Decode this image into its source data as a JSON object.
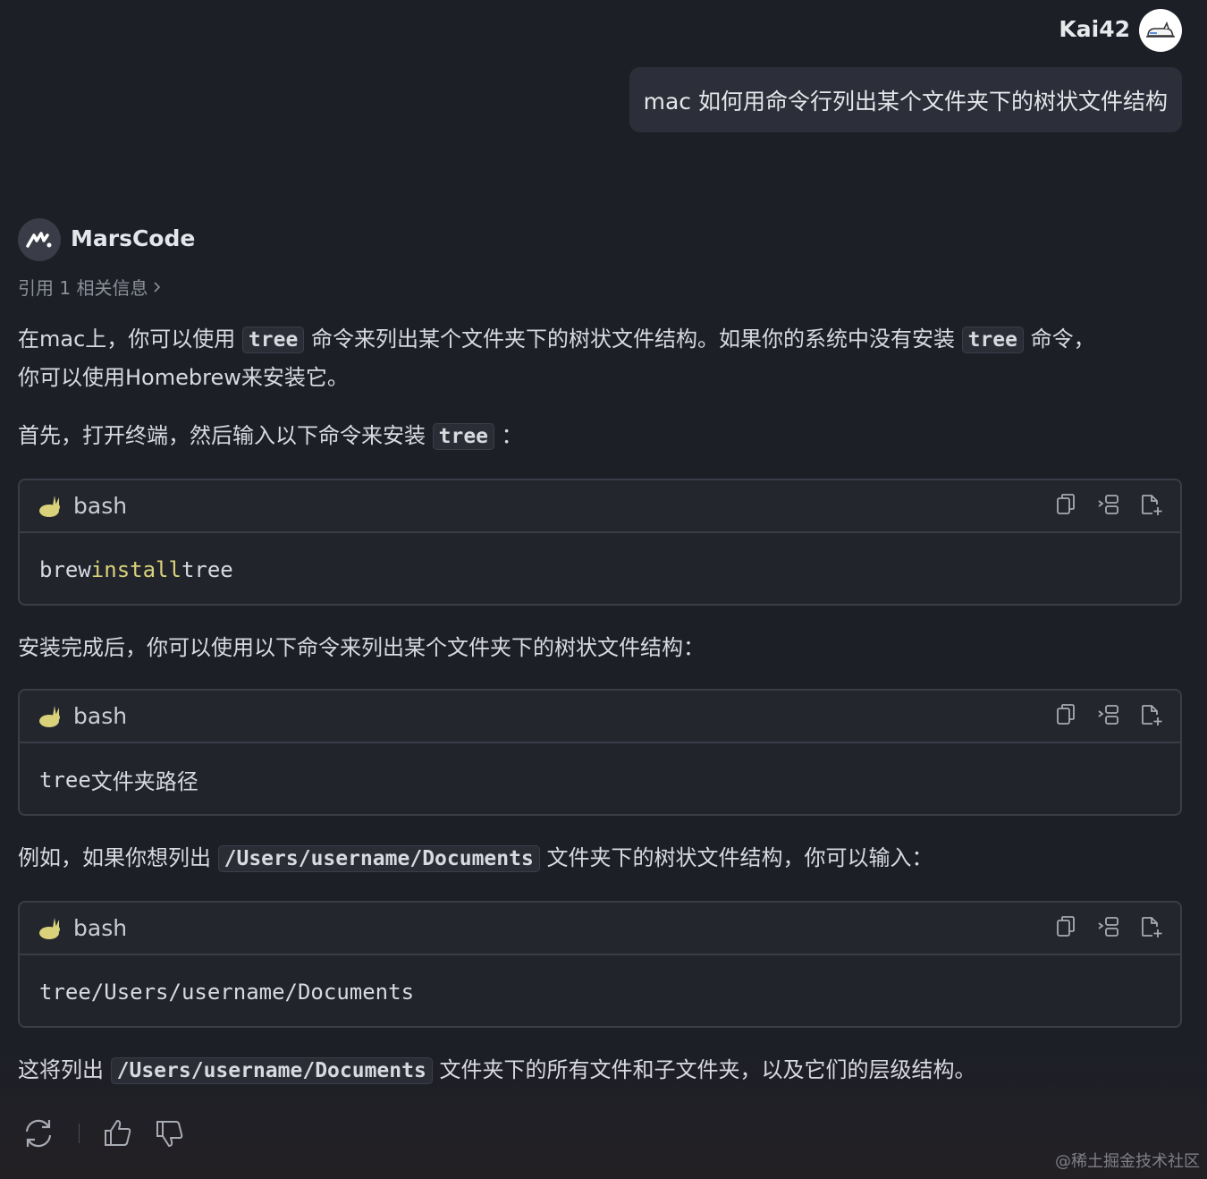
{
  "user": {
    "name": "Kai42",
    "question": "mac 如何用命令行列出某个文件夹下的树状文件结构"
  },
  "bot": {
    "name": "MarsCode",
    "citations": "引用 1 相关信息"
  },
  "content": {
    "p1_a": "在mac上，你可以使用",
    "p1_code1": "tree",
    "p1_b": "命令来列出某个文件夹下的树状文件结构。如果你的系统中没有安装",
    "p1_code2": "tree",
    "p1_c": "命令，",
    "p1_d": "你可以使用Homebrew来安装它。",
    "p2_a": "首先，打开终端，然后输入以下命令来安装",
    "p2_code": "tree",
    "p2_b": "：",
    "p3": "安装完成后，你可以使用以下命令来列出某个文件夹下的树状文件结构：",
    "p4_a": "例如，如果你想列出",
    "p4_code": "/Users/username/Documents",
    "p4_b": "文件夹下的树状文件结构，你可以输入：",
    "p5_a": "这将列出",
    "p5_code": "/Users/username/Documents",
    "p5_b": "文件夹下的所有文件和子文件夹，以及它们的层级结构。"
  },
  "code_blocks": [
    {
      "lang": "bash",
      "cmd": "brew",
      "kw": "install",
      "arg": "tree"
    },
    {
      "lang": "bash",
      "cmd": "tree",
      "arg": "文件夹路径"
    },
    {
      "lang": "bash",
      "cmd": "tree",
      "arg": "/Users/username/Documents"
    }
  ],
  "icons": {
    "copy": "copy-icon",
    "insert": "insert-icon",
    "new_file": "new-file-icon",
    "regenerate": "refresh-icon",
    "like": "thumbs-up-icon",
    "dislike": "thumbs-down-icon"
  },
  "watermark": "@稀土掘金技术社区",
  "colors": {
    "background": "#1d1f27",
    "bubble": "#2c2f39",
    "keyword": "#d9d27a"
  }
}
